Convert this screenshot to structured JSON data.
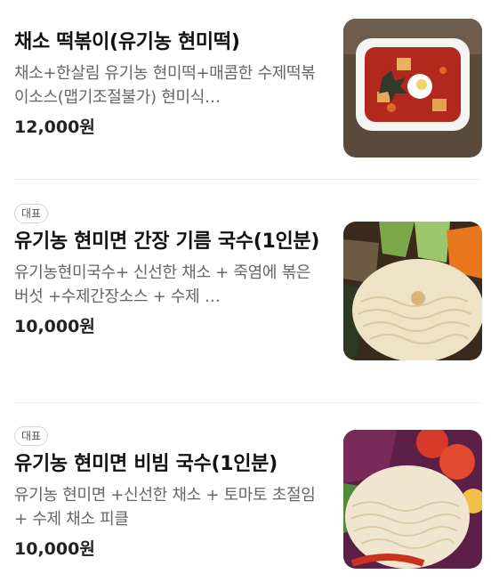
{
  "menu": {
    "items": [
      {
        "badge": "",
        "title": "채소 떡볶이(유기농 현미떡)",
        "description": "채소+한살림 유기농 현미떡+매콤한 수제떡볶이소스(맵기조절불가) 현미식…",
        "price": "12,000원",
        "image_icon": "tteokbokki-photo"
      },
      {
        "badge": "대표",
        "title": "유기농 현미면 간장 기름 국수(1인분)",
        "description": "유기농현미국수+ 신선한 채소 + 죽염에 볶은 버섯 +수제간장소스 + 수제 …",
        "price": "10,000원",
        "image_icon": "soy-noodle-photo"
      },
      {
        "badge": "대표",
        "title": "유기농 현미면 비빔 국수(1인분)",
        "description": "유기농 현미면 +신선한 채소 + 토마토 초절임 + 수제 채소 피클",
        "price": "10,000원",
        "image_icon": "bibim-noodle-photo"
      }
    ]
  }
}
